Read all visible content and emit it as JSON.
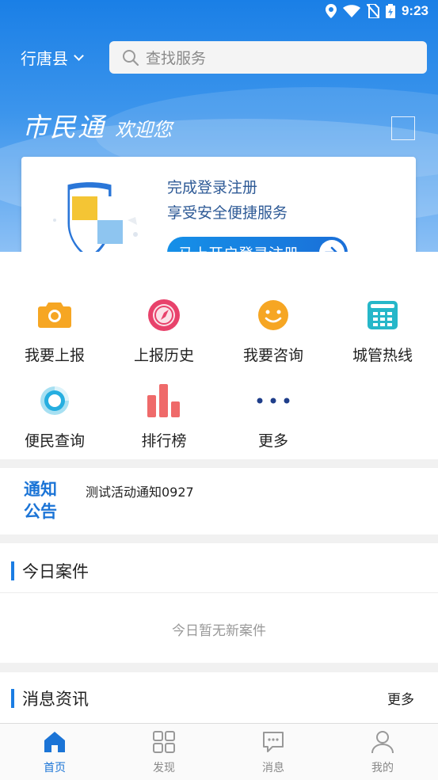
{
  "status_bar": {
    "time": "9:23"
  },
  "header": {
    "city": "行唐县",
    "search_placeholder": "查找服务"
  },
  "welcome": {
    "brand": "市民通",
    "greeting": "欢迎您"
  },
  "login_card": {
    "line1": "完成登录注册",
    "line2": "享受安全便捷服务",
    "button_label": "马上开启登录注册"
  },
  "grid": {
    "items": [
      {
        "label": "我要上报",
        "icon": "camera-icon"
      },
      {
        "label": "上报历史",
        "icon": "compass-icon"
      },
      {
        "label": "我要咨询",
        "icon": "smile-icon"
      },
      {
        "label": "城管热线",
        "icon": "phone-icon"
      },
      {
        "label": "便民查询",
        "icon": "chart-ring-icon"
      },
      {
        "label": "排行榜",
        "icon": "bar-chart-icon"
      },
      {
        "label": "更多",
        "icon": "more-dots-icon"
      }
    ]
  },
  "notice": {
    "tag_line1": "通知",
    "tag_line2": "公告",
    "message": "测试活动通知0927"
  },
  "today_cases": {
    "title": "今日案件",
    "empty_text": "今日暂无新案件"
  },
  "news": {
    "title": "消息资讯",
    "more_label": "更多"
  },
  "tabbar": {
    "tabs": [
      {
        "label": "首页",
        "icon": "home-icon",
        "active": true
      },
      {
        "label": "发现",
        "icon": "grid-icon",
        "active": false
      },
      {
        "label": "消息",
        "icon": "message-icon",
        "active": false
      },
      {
        "label": "我的",
        "icon": "user-icon",
        "active": false
      }
    ]
  },
  "colors": {
    "primary": "#1b7de3",
    "text": "#222222",
    "muted": "#888888"
  }
}
